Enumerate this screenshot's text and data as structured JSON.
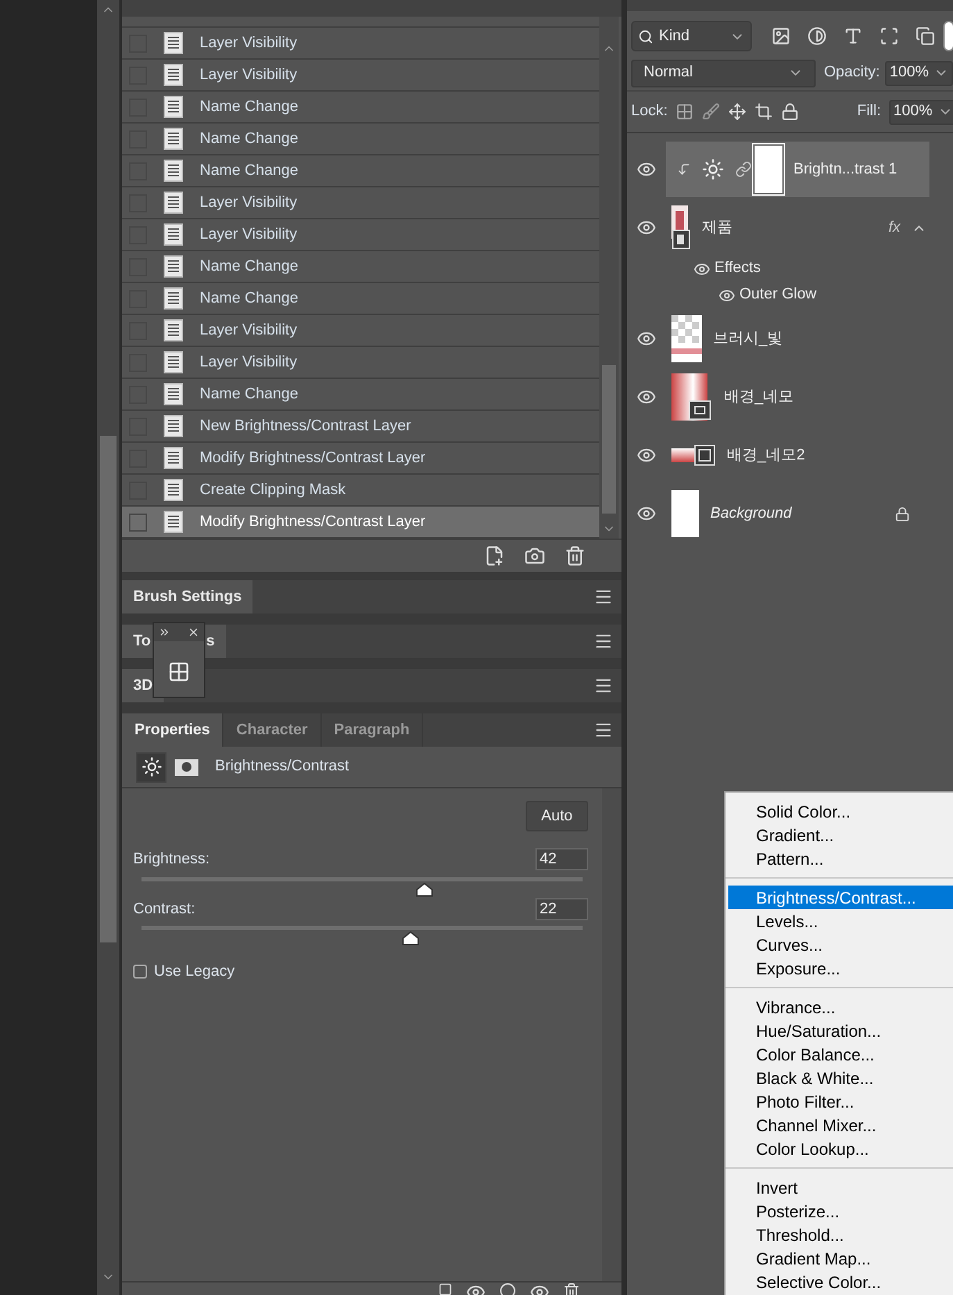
{
  "history": {
    "items": [
      {
        "label": "Layer Visibility",
        "selected": false
      },
      {
        "label": "Layer Visibility",
        "selected": false
      },
      {
        "label": "Name Change",
        "selected": false
      },
      {
        "label": "Name Change",
        "selected": false
      },
      {
        "label": "Name Change",
        "selected": false
      },
      {
        "label": "Layer Visibility",
        "selected": false
      },
      {
        "label": "Layer Visibility",
        "selected": false
      },
      {
        "label": "Name Change",
        "selected": false
      },
      {
        "label": "Name Change",
        "selected": false
      },
      {
        "label": "Layer Visibility",
        "selected": false
      },
      {
        "label": "Layer Visibility",
        "selected": false
      },
      {
        "label": "Name Change",
        "selected": false
      },
      {
        "label": "New Brightness/Contrast Layer",
        "selected": false
      },
      {
        "label": "Modify Brightness/Contrast Layer",
        "selected": false
      },
      {
        "label": "Create Clipping Mask",
        "selected": false
      },
      {
        "label": "Modify Brightness/Contrast Layer",
        "selected": true
      }
    ]
  },
  "collapsed_panels": [
    {
      "label": "Brush Settings"
    },
    {
      "label": "To",
      "label_end": "s"
    },
    {
      "label": "3D"
    }
  ],
  "properties": {
    "tabs": [
      {
        "label": "Properties",
        "selected": true
      },
      {
        "label": "Character",
        "selected": false
      },
      {
        "label": "Paragraph",
        "selected": false
      }
    ],
    "title": "Brightness/Contrast",
    "auto_button": "Auto",
    "sliders": [
      {
        "label": "Brightness:",
        "value": "42",
        "level": 0.64
      },
      {
        "label": "Contrast:",
        "value": "22",
        "level": 0.61
      }
    ],
    "use_legacy": {
      "label": "Use Legacy",
      "checked": false
    }
  },
  "layers": {
    "filter": "Kind",
    "blend_mode": "Normal",
    "opacity_label": "Opacity:",
    "opacity": "100%",
    "lock_label": "Lock:",
    "fill_label": "Fill:",
    "fill": "100%",
    "items": [
      {
        "name": "Brightn...trast 1",
        "kind": "adjustment",
        "visible": true,
        "selected": true,
        "clipped": true
      },
      {
        "name": "제품",
        "kind": "smart",
        "visible": true,
        "selected": false,
        "fx": "fx",
        "effects": [
          {
            "label": "Effects",
            "visible": true
          },
          {
            "label": "Outer Glow",
            "visible": true
          }
        ]
      },
      {
        "name": "브러시_빛",
        "kind": "pixel",
        "visible": true,
        "selected": false
      },
      {
        "name": "배경_네모",
        "kind": "shape",
        "visible": true,
        "selected": false
      },
      {
        "name": "배경_네모2",
        "kind": "shape_small",
        "visible": true,
        "selected": false
      },
      {
        "name": "Background",
        "kind": "background",
        "visible": true,
        "selected": false,
        "locked": true
      }
    ]
  },
  "adjustment_menu": {
    "groups": [
      [
        {
          "label": "Solid Color...",
          "selected": false
        },
        {
          "label": "Gradient...",
          "selected": false
        },
        {
          "label": "Pattern...",
          "selected": false
        }
      ],
      [
        {
          "label": "Brightness/Contrast...",
          "selected": true
        },
        {
          "label": "Levels...",
          "selected": false
        },
        {
          "label": "Curves...",
          "selected": false
        },
        {
          "label": "Exposure...",
          "selected": false
        }
      ],
      [
        {
          "label": "Vibrance...",
          "selected": false
        },
        {
          "label": "Hue/Saturation...",
          "selected": false
        },
        {
          "label": "Color Balance...",
          "selected": false
        },
        {
          "label": "Black & White...",
          "selected": false
        },
        {
          "label": "Photo Filter...",
          "selected": false
        },
        {
          "label": "Channel Mixer...",
          "selected": false
        },
        {
          "label": "Color Lookup...",
          "selected": false
        }
      ],
      [
        {
          "label": "Invert",
          "selected": false
        },
        {
          "label": "Posterize...",
          "selected": false
        },
        {
          "label": "Threshold...",
          "selected": false
        },
        {
          "label": "Gradient Map...",
          "selected": false
        },
        {
          "label": "Selective Color...",
          "selected": false
        }
      ]
    ]
  }
}
